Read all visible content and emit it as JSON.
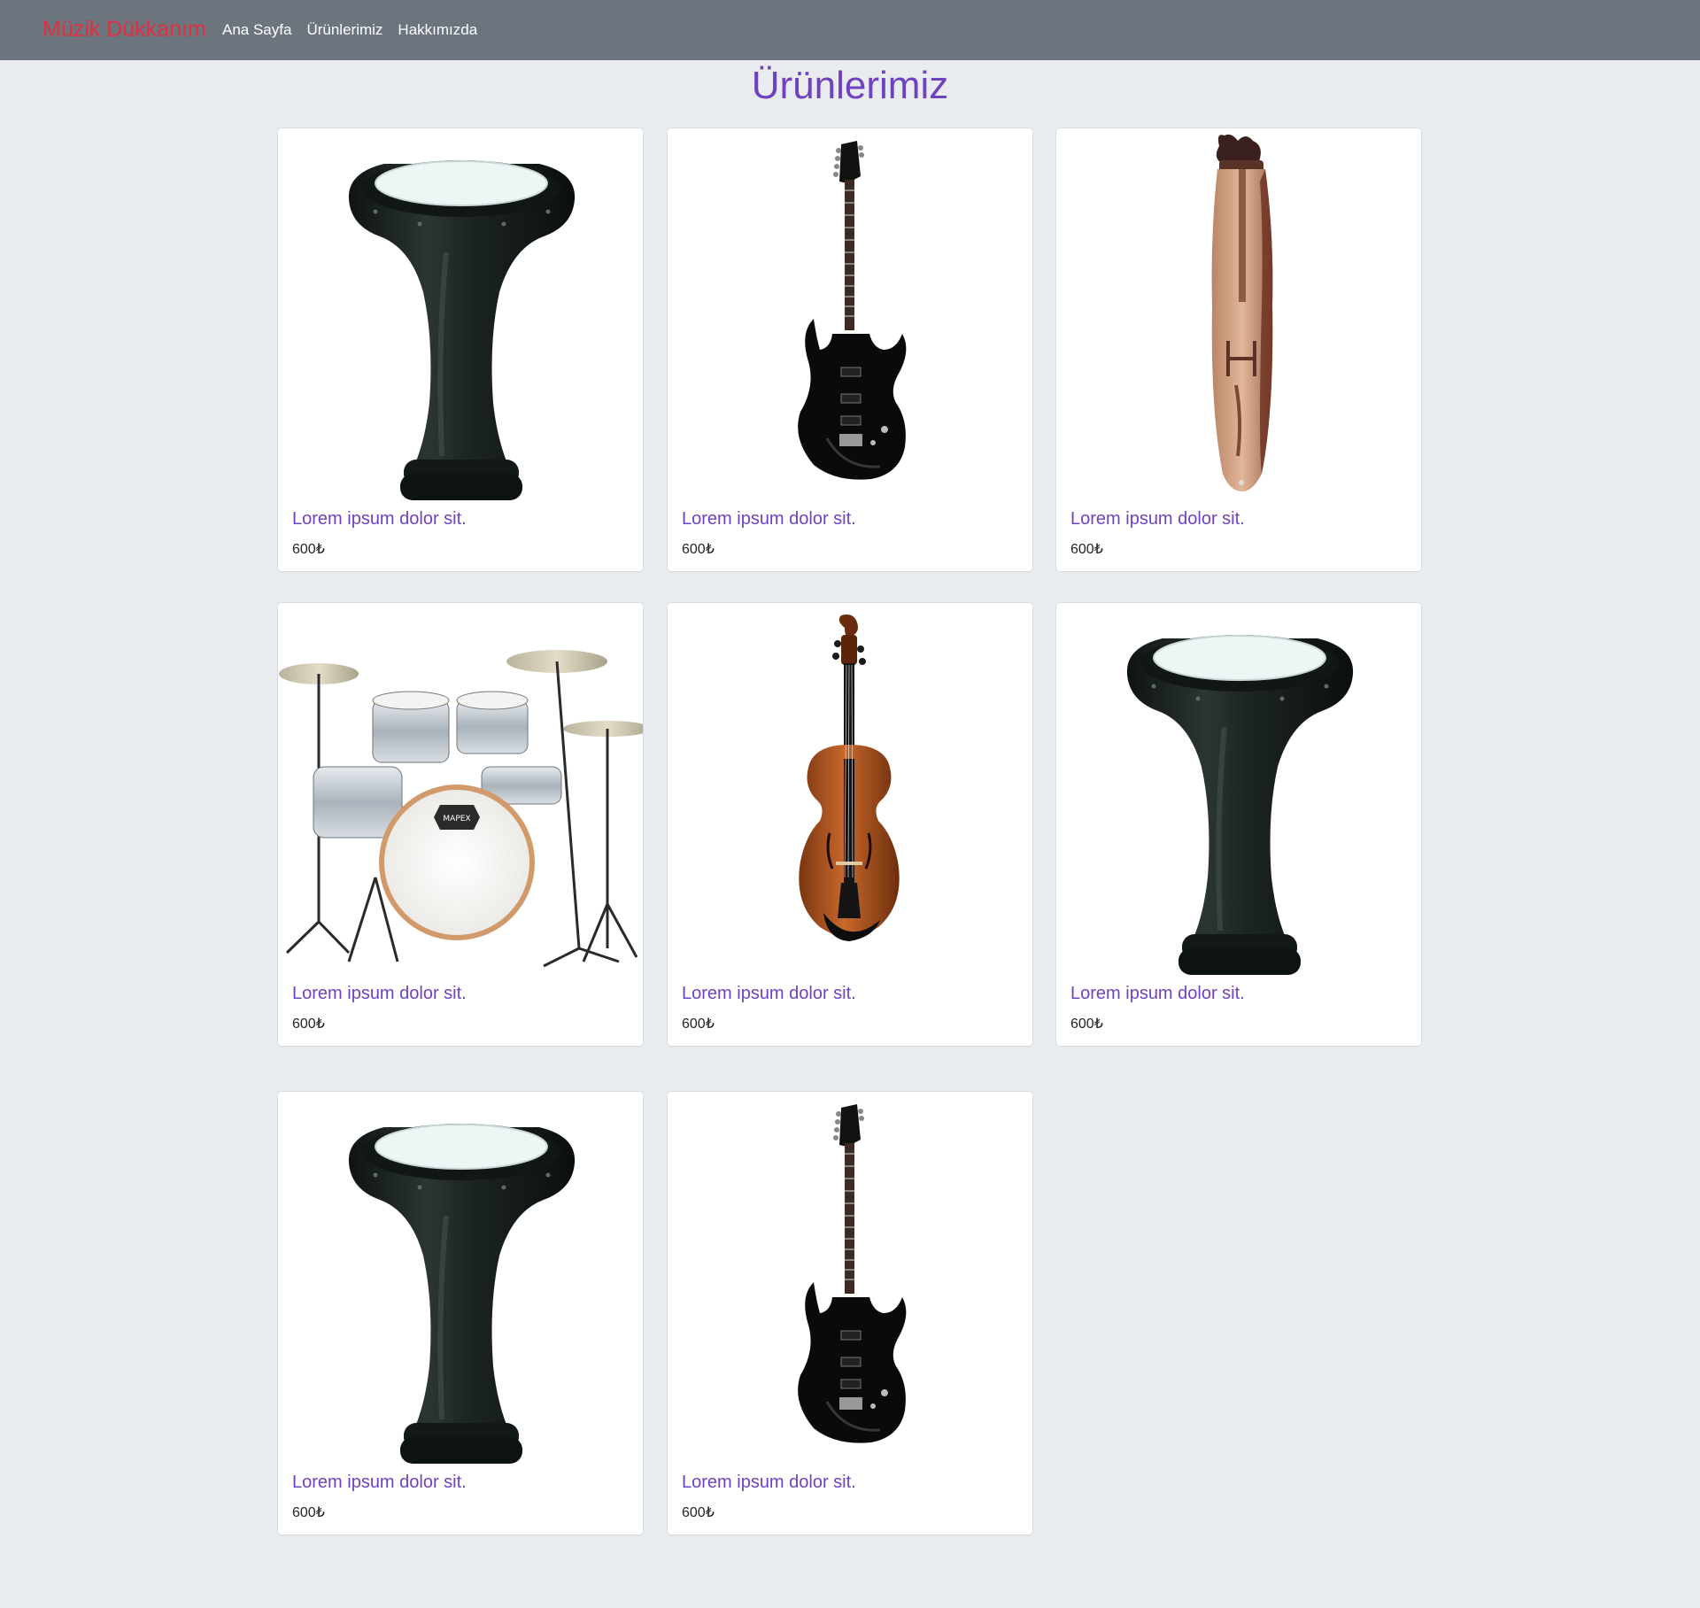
{
  "navbar": {
    "brand": "Müzik Dükkanım",
    "links": [
      "Ana Sayfa",
      "Ürünlerimiz",
      "Hakkımızda"
    ]
  },
  "page_title": "Ürünlerimiz",
  "products": [
    {
      "title": "Lorem ipsum dolor sit.",
      "price": "600₺",
      "image": "darbuka-icon"
    },
    {
      "title": "Lorem ipsum dolor sit.",
      "price": "600₺",
      "image": "electric-guitar-icon"
    },
    {
      "title": "Lorem ipsum dolor sit.",
      "price": "600₺",
      "image": "kemence-icon"
    },
    {
      "title": "Lorem ipsum dolor sit.",
      "price": "600₺",
      "image": "drum-kit-icon"
    },
    {
      "title": "Lorem ipsum dolor sit.",
      "price": "600₺",
      "image": "violin-icon"
    },
    {
      "title": "Lorem ipsum dolor sit.",
      "price": "600₺",
      "image": "darbuka-icon"
    },
    {
      "title": "Lorem ipsum dolor sit.",
      "price": "600₺",
      "image": "darbuka-icon"
    },
    {
      "title": "Lorem ipsum dolor sit.",
      "price": "600₺",
      "image": "electric-guitar-icon"
    }
  ],
  "colors": {
    "navbar_bg": "#6c757d",
    "brand": "#e0303f",
    "accent": "#6f42c1",
    "page_bg": "#e9ecef"
  }
}
